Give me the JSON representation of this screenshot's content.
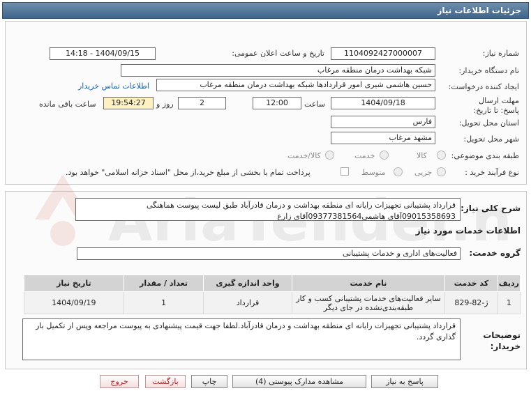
{
  "header": {
    "title": "جزئیات اطلاعات نیاز"
  },
  "fields": {
    "need_number_label": "شماره نیاز:",
    "need_number": "1104092427000007",
    "announce_label": "تاریخ و ساعت اعلان عمومی:",
    "announce_value": "1404/09/15 - 14:18",
    "buyer_org_label": "نام دستگاه خریدار:",
    "buyer_org": "شبکه بهداشت درمان منطقه مرغاب",
    "creator_label": "ایجاد کننده درخواست:",
    "creator": "حسین هاشمی شیری امور قراردادها شبکه بهداشت درمان منطقه مرغاب",
    "contact_link": "اطلاعات تماس خریدار",
    "deadline_label": "مهلت ارسال پاسخ: تا تاریخ:",
    "deadline_date": "1404/09/18",
    "time_label": "ساعت",
    "deadline_time": "12:00",
    "days_value": "2",
    "days_label": "روز و",
    "remaining_time": "19:54:27",
    "remaining_label": "ساعت باقی مانده",
    "province_label": "استان محل تحویل:",
    "province": "فارس",
    "city_label": "شهر محل تحویل:",
    "city": "مشهد مرغاب",
    "category_label": "طبقه بندی موضوعی:",
    "category_options": [
      "کالا",
      "خدمت",
      "کالا/خدمت"
    ],
    "process_label": "نوع فرآیند خرید :",
    "process_options": [
      "جزیی",
      "متوسط"
    ],
    "payment_note": "پرداخت تمام یا بخشی از مبلغ خرید،از محل \"اسناد خزانه اسلامی\" خواهد بود."
  },
  "summary": {
    "label": "شرح کلی نیاز:",
    "text": "قرارداد پشتیبانی تجهیزات رایانه ای منطقه بهداشت و درمان قادرآباد طبق لیست پیوست هماهنگی 09015358693آقای هاشمی09377381564آقای زارع"
  },
  "services": {
    "section_title": "اطلاعات خدمات مورد نیاز",
    "group_label": "گروه خدمت:",
    "group_value": "فعالیت‌های اداری و خدمات پشتیبانی",
    "columns": [
      "ردیف",
      "کد خدمت",
      "نام خدمت",
      "واحد اندازه گیری",
      "تعداد / مقدار",
      "تاریخ نیاز"
    ],
    "rows": [
      [
        "1",
        "ژ-82-829",
        "سایر فعالیت‌های خدمات پشتیبانی کسب و کار طبقه‌بندی‌نشده در جای دیگر",
        "قرارداد",
        "1",
        "1404/09/19"
      ]
    ]
  },
  "buyer_notes": {
    "label": "توضیحات خریدار:",
    "text": "قرارداد پشتیبانی تجهیزات رایانه ای منطقه بهداشت و درمان قادرآباد.لطفا جهت قیمت پیشنهادی به پیوست مراجعه وپس از تکمیل بار گذاری گردد."
  },
  "buttons": {
    "reply": "پاسخ به نیاز",
    "attachments": "مشاهده مدارک پیوستی (4)",
    "print": "چاپ",
    "back": "بازگشت",
    "exit": "خروج"
  },
  "watermark": {
    "text": "AriaTender.net"
  },
  "colors": {
    "title_bar": "#4a6f94",
    "link": "#1a5fb4",
    "timer_bg": "#fdf1c2"
  }
}
